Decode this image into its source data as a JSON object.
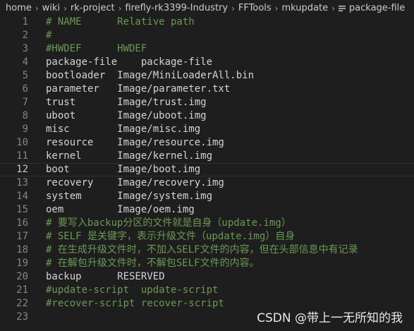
{
  "breadcrumb": {
    "items": [
      "home",
      "wiki",
      "rk-project",
      "firefly-rk3399-Industry",
      "FFTools",
      "mkupdate"
    ],
    "file": "package-file",
    "file_icon": "lines-icon"
  },
  "editor": {
    "current_line": 12,
    "colors": {
      "background": "#1e1e1e",
      "comment": "#6a9955",
      "text": "#d4d4d4",
      "line_number": "#858585"
    },
    "lines": [
      {
        "n": "1",
        "text": "# NAME      Relative path",
        "type": "comment"
      },
      {
        "n": "2",
        "text": "#",
        "type": "comment"
      },
      {
        "n": "3",
        "text": "#HWDEF      HWDEF",
        "type": "comment"
      },
      {
        "n": "4",
        "text": "package-file    package-file",
        "type": "text"
      },
      {
        "n": "5",
        "text": "bootloader  Image/MiniLoaderAll.bin",
        "type": "text"
      },
      {
        "n": "6",
        "text": "parameter   Image/parameter.txt",
        "type": "text"
      },
      {
        "n": "7",
        "text": "trust       Image/trust.img",
        "type": "text"
      },
      {
        "n": "8",
        "text": "uboot       Image/uboot.img",
        "type": "text"
      },
      {
        "n": "9",
        "text": "misc        Image/misc.img",
        "type": "text"
      },
      {
        "n": "10",
        "text": "resource    Image/resource.img",
        "type": "text"
      },
      {
        "n": "11",
        "text": "kernel      Image/kernel.img",
        "type": "text"
      },
      {
        "n": "12",
        "text": "boot        Image/boot.img",
        "type": "text"
      },
      {
        "n": "13",
        "text": "recovery    Image/recovery.img",
        "type": "text"
      },
      {
        "n": "14",
        "text": "system      Image/system.img",
        "type": "text"
      },
      {
        "n": "15",
        "text": "oem         Image/oem.img",
        "type": "text"
      },
      {
        "n": "16",
        "text": "# 要写入backup分区的文件就是自身（update.img）",
        "type": "comment"
      },
      {
        "n": "17",
        "text": "# SELF 是关键字，表示升级文件（update.img）自身",
        "type": "comment"
      },
      {
        "n": "18",
        "text": "# 在生成升级文件时，不加入SELF文件的内容，但在头部信息中有记录",
        "type": "comment"
      },
      {
        "n": "19",
        "text": "# 在解包升级文件时，不解包SELF文件的内容。",
        "type": "comment"
      },
      {
        "n": "20",
        "text": "backup      RESERVED",
        "type": "text"
      },
      {
        "n": "21",
        "text": "#update-script  update-script",
        "type": "comment"
      },
      {
        "n": "22",
        "text": "#recover-script recover-script",
        "type": "comment"
      },
      {
        "n": "23",
        "text": "",
        "type": "text"
      }
    ]
  },
  "watermark": "CSDN @带上一无所知的我"
}
